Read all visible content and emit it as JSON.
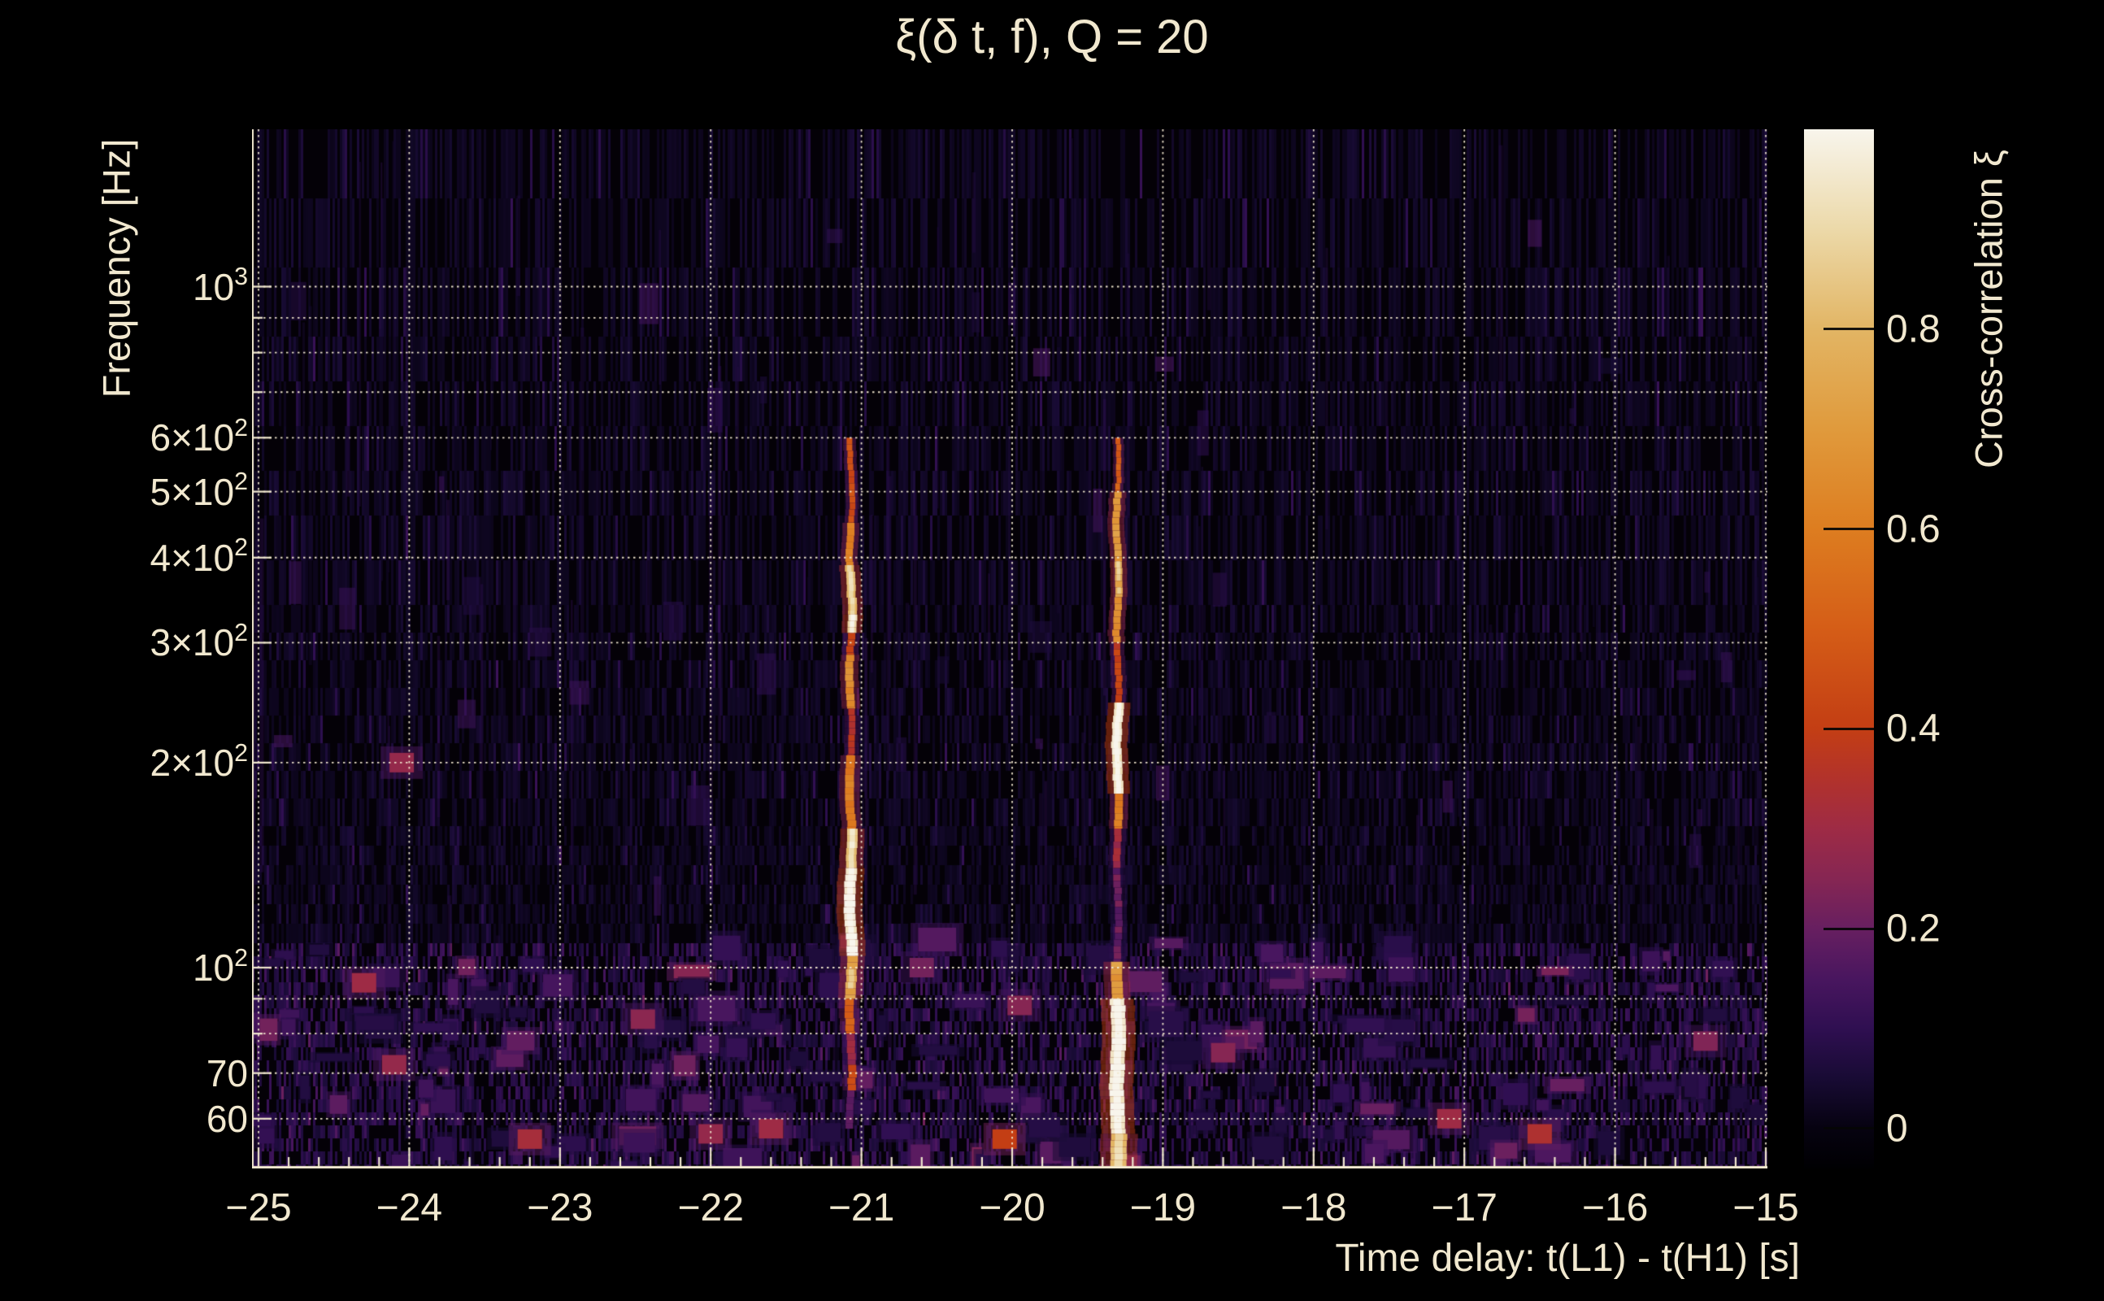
{
  "page": {
    "background": "#000000",
    "text_color": "#f1e8cf"
  },
  "chart_data": {
    "type": "heatmap",
    "title": "ξ(δ t, f), Q = 20",
    "xlabel": "Time delay: t(L1) - t(H1) [s]",
    "ylabel": "Frequency [Hz]",
    "x_axis": {
      "lim": [
        -25.05,
        -14.99
      ],
      "ticks": [
        {
          "label": "−25",
          "value": -25
        },
        {
          "label": "−24",
          "value": -24
        },
        {
          "label": "−23",
          "value": -23
        },
        {
          "label": "−22",
          "value": -22
        },
        {
          "label": "−21",
          "value": -21
        },
        {
          "label": "−20",
          "value": -20
        },
        {
          "label": "−19",
          "value": -19
        },
        {
          "label": "−18",
          "value": -18
        },
        {
          "label": "−17",
          "value": -17
        },
        {
          "label": "−16",
          "value": -16
        },
        {
          "label": "−15",
          "value": -15
        }
      ],
      "minor_step": 0.2,
      "grid": "dotted"
    },
    "y_axis": {
      "scale": "log",
      "lim_hz": [
        50.7,
        1703
      ],
      "ticks": [
        {
          "base": "10",
          "exp": "3",
          "value": 1000
        },
        {
          "base": "6×10",
          "exp": "2",
          "value": 600
        },
        {
          "base": "5×10",
          "exp": "2",
          "value": 500
        },
        {
          "base": "4×10",
          "exp": "2",
          "value": 400
        },
        {
          "base": "3×10",
          "exp": "2",
          "value": 300
        },
        {
          "base": "2×10",
          "exp": "2",
          "value": 200
        },
        {
          "base": "10",
          "exp": "2",
          "value": 100
        },
        {
          "base": "70",
          "exp": "",
          "value": 70
        },
        {
          "base": "60",
          "exp": "",
          "value": 60
        }
      ],
      "minor_grid_hz": [
        900,
        800,
        700,
        90,
        80
      ],
      "grid": "dotted"
    },
    "colorbar": {
      "label": "Cross-correlation ξ",
      "vmin": -0.04,
      "vmax": 1.0,
      "ticks": [
        {
          "label": "0.8",
          "value": 0.8
        },
        {
          "label": "0.6",
          "value": 0.6
        },
        {
          "label": "0.4",
          "value": 0.4
        },
        {
          "label": "0.2",
          "value": 0.2
        },
        {
          "label": "0",
          "value": 0.0
        }
      ],
      "colormap_stops": [
        [
          0.0,
          "#060210"
        ],
        [
          0.05,
          "#180b34"
        ],
        [
          0.1,
          "#2f0f51"
        ],
        [
          0.15,
          "#49165f"
        ],
        [
          0.2,
          "#671f60"
        ],
        [
          0.25,
          "#862653"
        ],
        [
          0.3,
          "#9e2b45"
        ],
        [
          0.35,
          "#b2322b"
        ],
        [
          0.4,
          "#c33e14"
        ],
        [
          0.5,
          "#d55d17"
        ],
        [
          0.6,
          "#dd7d20"
        ],
        [
          0.7,
          "#e09a3c"
        ],
        [
          0.8,
          "#e2b564"
        ],
        [
          0.9,
          "#ecd9a9"
        ],
        [
          1.0,
          "#f8f5ec"
        ]
      ]
    },
    "streaks": [
      {
        "x": -21.07,
        "segments": [
          {
            "f_hi": 600,
            "f_lo": 450,
            "xi": 0.45,
            "w": 7
          },
          {
            "f_hi": 450,
            "f_lo": 390,
            "xi": 0.6,
            "w": 9
          },
          {
            "f_hi": 390,
            "f_lo": 330,
            "xi": 0.8,
            "w": 11
          },
          {
            "f_hi": 330,
            "f_lo": 310,
            "xi": 0.9,
            "w": 11
          },
          {
            "f_hi": 310,
            "f_lo": 288,
            "xi": 0.4,
            "w": 9
          },
          {
            "f_hi": 288,
            "f_lo": 240,
            "xi": 0.65,
            "w": 10
          },
          {
            "f_hi": 240,
            "f_lo": 205,
            "xi": 0.35,
            "w": 8
          },
          {
            "f_hi": 205,
            "f_lo": 160,
            "xi": 0.6,
            "w": 11
          },
          {
            "f_hi": 160,
            "f_lo": 140,
            "xi": 0.85,
            "w": 13
          },
          {
            "f_hi": 140,
            "f_lo": 104,
            "xi": 0.97,
            "w": 14
          },
          {
            "f_hi": 104,
            "f_lo": 90,
            "xi": 0.75,
            "w": 13
          },
          {
            "f_hi": 90,
            "f_lo": 80,
            "xi": 0.5,
            "w": 11
          },
          {
            "f_hi": 80,
            "f_lo": 72,
            "xi": 0.3,
            "w": 10
          },
          {
            "f_hi": 72,
            "f_lo": 66,
            "xi": 0.45,
            "w": 10
          },
          {
            "f_hi": 66,
            "f_lo": 58,
            "xi": 0.2,
            "w": 9
          }
        ]
      },
      {
        "x": -19.3,
        "segments": [
          {
            "f_hi": 600,
            "f_lo": 500,
            "xi": 0.5,
            "w": 6
          },
          {
            "f_hi": 500,
            "f_lo": 395,
            "xi": 0.7,
            "w": 9
          },
          {
            "f_hi": 395,
            "f_lo": 350,
            "xi": 0.75,
            "w": 9
          },
          {
            "f_hi": 350,
            "f_lo": 300,
            "xi": 0.65,
            "w": 9
          },
          {
            "f_hi": 300,
            "f_lo": 245,
            "xi": 0.4,
            "w": 8
          },
          {
            "f_hi": 245,
            "f_lo": 180,
            "xi": 0.95,
            "w": 12
          },
          {
            "f_hi": 180,
            "f_lo": 160,
            "xi": 0.6,
            "w": 10
          },
          {
            "f_hi": 160,
            "f_lo": 140,
            "xi": 0.3,
            "w": 9
          },
          {
            "f_hi": 140,
            "f_lo": 102,
            "xi": 0.2,
            "w": 9
          },
          {
            "f_hi": 102,
            "f_lo": 90,
            "xi": 0.7,
            "w": 14
          },
          {
            "f_hi": 90,
            "f_lo": 57,
            "xi": 0.97,
            "w": 18
          },
          {
            "f_hi": 57,
            "f_lo": 51,
            "xi": 0.8,
            "w": 20
          }
        ]
      }
    ],
    "hot_spots": [
      {
        "x": -24.05,
        "f": 200,
        "xi": 0.28
      },
      {
        "x": -24.3,
        "f": 95,
        "xi": 0.3
      },
      {
        "x": -24.1,
        "f": 72,
        "xi": 0.28
      },
      {
        "x": -23.2,
        "f": 56,
        "xi": 0.32
      },
      {
        "x": -22.45,
        "f": 84,
        "xi": 0.26
      },
      {
        "x": -22.0,
        "f": 57,
        "xi": 0.28
      },
      {
        "x": -21.6,
        "f": 58,
        "xi": 0.3
      },
      {
        "x": -20.6,
        "f": 100,
        "xi": 0.22
      },
      {
        "x": -20.05,
        "f": 56,
        "xi": 0.4
      },
      {
        "x": -19.95,
        "f": 88,
        "xi": 0.25
      },
      {
        "x": -18.6,
        "f": 75,
        "xi": 0.25
      },
      {
        "x": -17.1,
        "f": 60,
        "xi": 0.3
      },
      {
        "x": -16.5,
        "f": 57,
        "xi": 0.34
      },
      {
        "x": -15.4,
        "f": 78,
        "xi": 0.24
      }
    ],
    "noise": {
      "seed": 1337,
      "base_level": 0.05,
      "low_band_hz": 110,
      "low_band_level": 0.18
    }
  }
}
